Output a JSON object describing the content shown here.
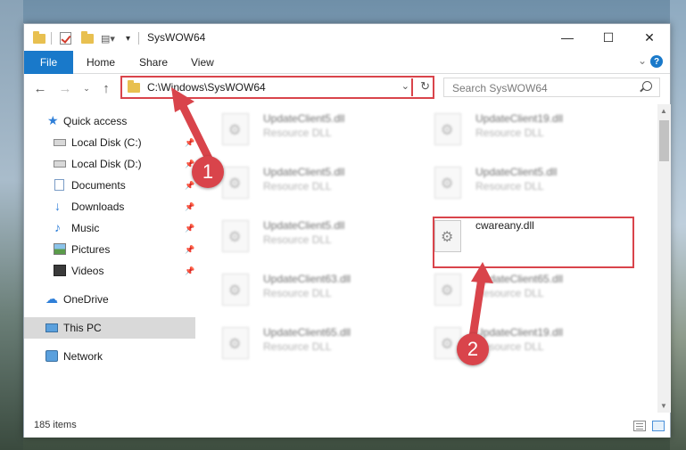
{
  "window": {
    "title": "SysWOW64",
    "minimize_glyph": "—",
    "maximize_glyph": "☐",
    "close_glyph": "✕"
  },
  "ribbon": {
    "file": "File",
    "tabs": [
      "Home",
      "Share",
      "View"
    ],
    "help": "?"
  },
  "address": {
    "path": "C:\\Windows\\SysWOW64",
    "search_placeholder": "Search SysWOW64"
  },
  "nav": {
    "items": [
      {
        "label": "Quick access",
        "icon": "star-icon",
        "pinned": false
      },
      {
        "label": "Local Disk (C:)",
        "icon": "drive-icon",
        "pinned": true
      },
      {
        "label": "Local Disk (D:)",
        "icon": "drive-icon",
        "pinned": true
      },
      {
        "label": "Documents",
        "icon": "documents-icon",
        "pinned": true
      },
      {
        "label": "Downloads",
        "icon": "downloads-icon",
        "pinned": true
      },
      {
        "label": "Music",
        "icon": "music-icon",
        "pinned": true
      },
      {
        "label": "Pictures",
        "icon": "pictures-icon",
        "pinned": true
      },
      {
        "label": "Videos",
        "icon": "videos-icon",
        "pinned": true
      },
      {
        "label": "OneDrive",
        "icon": "cloud-icon",
        "pinned": false
      },
      {
        "label": "This PC",
        "icon": "pc-icon",
        "pinned": false,
        "selected": true
      },
      {
        "label": "Network",
        "icon": "network-icon",
        "pinned": false
      }
    ]
  },
  "files": [
    {
      "name": "UpdateClient5.dll",
      "type": "Resource DLL",
      "blurred": true
    },
    {
      "name": "UpdateClient19.dll",
      "type": "Resource DLL",
      "blurred": true
    },
    {
      "name": "UpdateClient5.dll",
      "type": "Resource DLL",
      "blurred": true
    },
    {
      "name": "UpdateClient5.dll",
      "type": "Resource DLL",
      "blurred": true
    },
    {
      "name": "UpdateClient5.dll",
      "type": "Resource DLL",
      "blurred": true
    },
    {
      "name": "cwareany.dll",
      "type": "",
      "blurred": false
    },
    {
      "name": "UpdateClient63.dll",
      "type": "Resource DLL",
      "blurred": true
    },
    {
      "name": "UpdateClient65.dll",
      "type": "Resource DLL",
      "blurred": true
    },
    {
      "name": "UpdateClient65.dll",
      "type": "Resource DLL",
      "blurred": true
    },
    {
      "name": "UpdateClient19.dll",
      "type": "Resource DLL",
      "blurred": true
    }
  ],
  "status": {
    "count": "185 items"
  },
  "annotations": {
    "badge1": "1",
    "badge2": "2",
    "color": "#d9444b"
  }
}
